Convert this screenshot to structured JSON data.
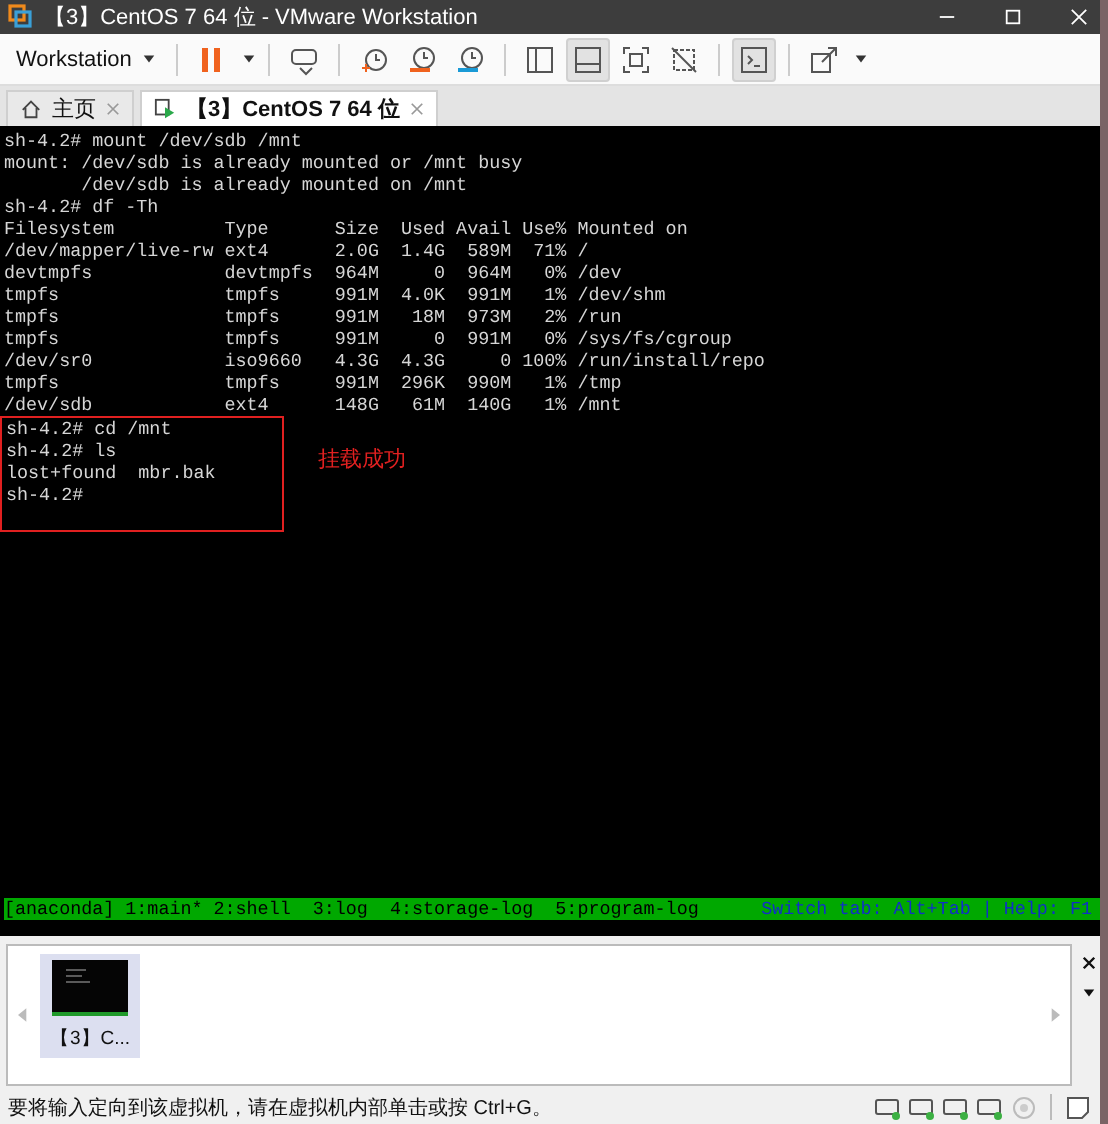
{
  "window": {
    "title": "【3】CentOS 7 64 位 - VMware Workstation"
  },
  "toolbar": {
    "menu_label": "Workstation",
    "buttons": [
      {
        "kind": "pause",
        "pressed": false
      },
      {
        "kind": "send",
        "pressed": false
      },
      {
        "kind": "snap-take",
        "pressed": false
      },
      {
        "kind": "snap-revert",
        "pressed": false
      },
      {
        "kind": "snap-manage",
        "pressed": false
      },
      {
        "kind": "view-side",
        "pressed": false
      },
      {
        "kind": "view-bottom",
        "pressed": true
      },
      {
        "kind": "fullscreen",
        "pressed": false
      },
      {
        "kind": "unity",
        "pressed": false
      },
      {
        "kind": "console",
        "pressed": true
      },
      {
        "kind": "stretch",
        "pressed": false
      }
    ]
  },
  "tabs": [
    {
      "label": "主页",
      "kind": "home",
      "selected": false
    },
    {
      "label": "【3】CentOS 7 64 位",
      "kind": "vm",
      "selected": true
    }
  ],
  "terminal": {
    "lines": [
      "sh-4.2# mount /dev/sdb /mnt",
      "mount: /dev/sdb is already mounted or /mnt busy",
      "       /dev/sdb is already mounted on /mnt",
      "sh-4.2# df -Th",
      "Filesystem          Type      Size  Used Avail Use% Mounted on",
      "/dev/mapper/live-rw ext4      2.0G  1.4G  589M  71% /",
      "devtmpfs            devtmpfs  964M     0  964M   0% /dev",
      "tmpfs               tmpfs     991M  4.0K  991M   1% /dev/shm",
      "tmpfs               tmpfs     991M   18M  973M   2% /run",
      "tmpfs               tmpfs     991M     0  991M   0% /sys/fs/cgroup",
      "/dev/sr0            iso9660   4.3G  4.3G     0 100% /run/install/repo",
      "tmpfs               tmpfs     991M  296K  990M   1% /tmp",
      "/dev/sdb            ext4      148G   61M  140G   1% /mnt"
    ],
    "highlight": {
      "lines": [
        "sh-4.2# cd /mnt",
        "sh-4.2# ls",
        "lost+found  mbr.bak",
        "sh-4.2#"
      ],
      "label": "挂载成功"
    },
    "status_left": "[anaconda] 1:main* 2:shell  3:log  4:storage-log  5:program-log",
    "status_right": "Switch tab: Alt+Tab | Help: F1"
  },
  "thumbnails": [
    {
      "label": "【3】C...",
      "selected": true
    }
  ],
  "status_bar": {
    "message": "要将输入定向到该虚拟机，请在虚拟机内部单击或按 Ctrl+G。"
  }
}
